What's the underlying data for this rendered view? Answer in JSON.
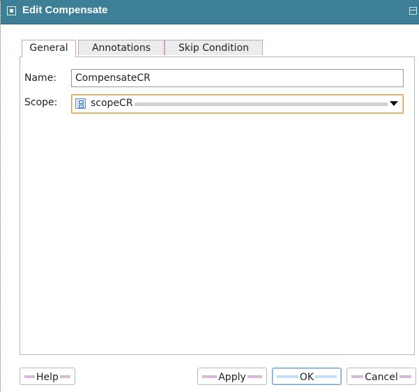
{
  "window": {
    "title": "Edit Compensate"
  },
  "tabs": [
    {
      "label": "General",
      "active": true
    },
    {
      "label": "Annotations",
      "active": false
    },
    {
      "label": "Skip Condition",
      "active": false
    }
  ],
  "form": {
    "name_label": "Name:",
    "name_value": "CompensateCR",
    "scope_label": "Scope:",
    "scope_value": "scopeCR"
  },
  "buttons": {
    "help": "Help",
    "apply": "Apply",
    "ok": "OK",
    "cancel": "Cancel"
  },
  "colors": {
    "title_bar": "#3c7f96",
    "focus_border": "#d9a04a",
    "default_button_border": "#6f9fd0"
  },
  "icons": {
    "window": "window-menu-icon",
    "scope": "scope-icon",
    "dropdown": "chevron-down-icon"
  }
}
